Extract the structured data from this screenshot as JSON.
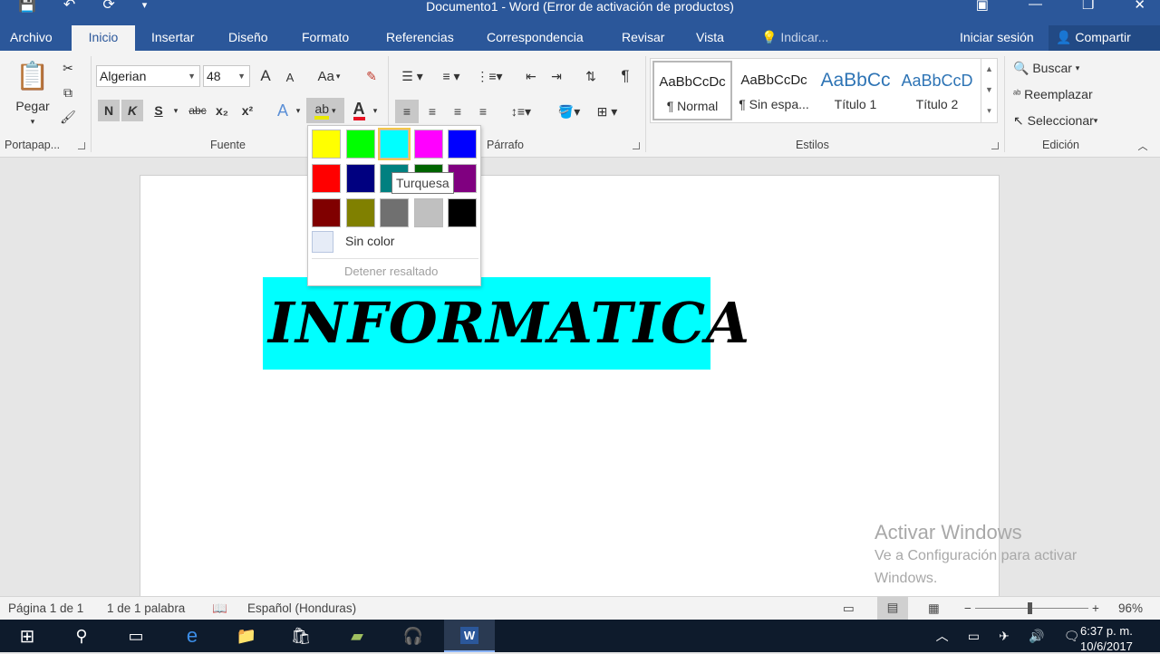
{
  "titlebar": {
    "title": "Documento1 - Word (Error de activación de productos)"
  },
  "tabs": [
    {
      "label": "Archivo"
    },
    {
      "label": "Inicio"
    },
    {
      "label": "Insertar"
    },
    {
      "label": "Diseño"
    },
    {
      "label": "Formato"
    },
    {
      "label": "Referencias"
    },
    {
      "label": "Correspondencia"
    },
    {
      "label": "Revisar"
    },
    {
      "label": "Vista"
    },
    {
      "label": "Indicar..."
    }
  ],
  "account": {
    "signin": "Iniciar sesión",
    "share": "Compartir"
  },
  "clipboard": {
    "paste_label": "Pegar",
    "group_label": "Portapap..."
  },
  "font": {
    "name": "Algerian",
    "size": "48",
    "bold_label": "N",
    "italic_label": "K",
    "underline_label": "S",
    "strike_label": "abc",
    "subscript_label": "x₂",
    "superscript_label": "x²",
    "case_label": "Aa",
    "grow_label": "A",
    "shrink_label": "A",
    "group_label": "Fuente"
  },
  "paragraph": {
    "group_label": "Párrafo"
  },
  "styles": {
    "items": [
      {
        "preview": "AaBbCcDc",
        "label": "¶ Normal"
      },
      {
        "preview": "AaBbCcDc",
        "label": "¶ Sin espa..."
      },
      {
        "preview": "AaBbCc",
        "label": "Título 1"
      },
      {
        "preview": "AaBbCcD",
        "label": "Título 2"
      }
    ],
    "group_label": "Estilos"
  },
  "editing": {
    "find": "Buscar",
    "replace": "Reemplazar",
    "select": "Seleccionar",
    "group_label": "Edición"
  },
  "highlight_menu": {
    "colors": [
      {
        "name": "Amarillo",
        "hex": "#ffff00"
      },
      {
        "name": "Verde brillante",
        "hex": "#00ff00"
      },
      {
        "name": "Turquesa",
        "hex": "#00ffff"
      },
      {
        "name": "Rosa",
        "hex": "#ff00ff"
      },
      {
        "name": "Azul",
        "hex": "#0000ff"
      },
      {
        "name": "Rojo",
        "hex": "#ff0000"
      },
      {
        "name": "Azul oscuro",
        "hex": "#000080"
      },
      {
        "name": "Verde azulado",
        "hex": "#008080"
      },
      {
        "name": "Verde",
        "hex": "#006400"
      },
      {
        "name": "Violeta",
        "hex": "#800080"
      },
      {
        "name": "Rojo oscuro",
        "hex": "#800000"
      },
      {
        "name": "Amarillo oscuro",
        "hex": "#808000"
      },
      {
        "name": "Gris 50%",
        "hex": "#707070"
      },
      {
        "name": "Gris 25%",
        "hex": "#c0c0c0"
      },
      {
        "name": "Negro",
        "hex": "#000000"
      }
    ],
    "selected_index": 2,
    "no_color": "Sin color",
    "stop": "Detener resaltado",
    "tooltip": "Turquesa"
  },
  "document": {
    "text": "INFORMATICA",
    "highlight_color": "#00ffff"
  },
  "watermark": {
    "title": "Activar Windows",
    "line1": "Ve a Configuración para activar",
    "line2": "Windows."
  },
  "status": {
    "page": "Página 1 de 1",
    "words": "1 de 1 palabra",
    "language": "Español (Honduras)",
    "zoom": "96%",
    "zoom_value": 96
  },
  "taskbar": {
    "time": "6:37 p. m.",
    "date": "10/6/2017"
  },
  "colors": {
    "accent": "#2b579a",
    "highlight": "#00ffff",
    "font_color": "#e81123"
  }
}
